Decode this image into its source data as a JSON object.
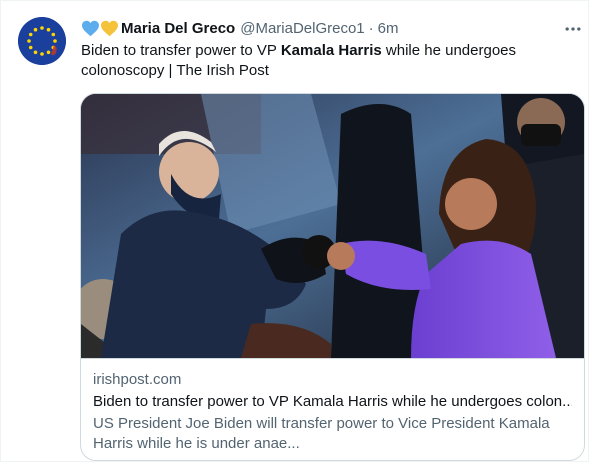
{
  "tweet": {
    "display_name": "Maria Del Greco",
    "handle": "@MariaDelGreco1",
    "separator": "·",
    "time": "6m",
    "more_label": "···",
    "text_before": "Biden to transfer power to VP ",
    "text_bold": "Kamala Harris",
    "text_after": " while he undergoes colonoscopy | The Irish Post"
  },
  "card": {
    "domain": "irishpost.com",
    "title": "Biden to transfer power to VP Kamala Harris while he undergoes colon...",
    "description": "US President Joe Biden will transfer power to Vice President Kamala Harris while he is under anae..."
  },
  "icons": {
    "avatar": "eu-flag-avatar",
    "hearts": [
      "blue-heart-icon",
      "yellow-heart-icon"
    ],
    "more": "more-options-icon"
  },
  "colors": {
    "name": "#0f1419",
    "secondary": "#536471",
    "blue_heart": "#5dadec",
    "yellow_heart": "#f5c33b",
    "eu_blue": "#1a3f9c",
    "card_border": "#cfd9de"
  }
}
